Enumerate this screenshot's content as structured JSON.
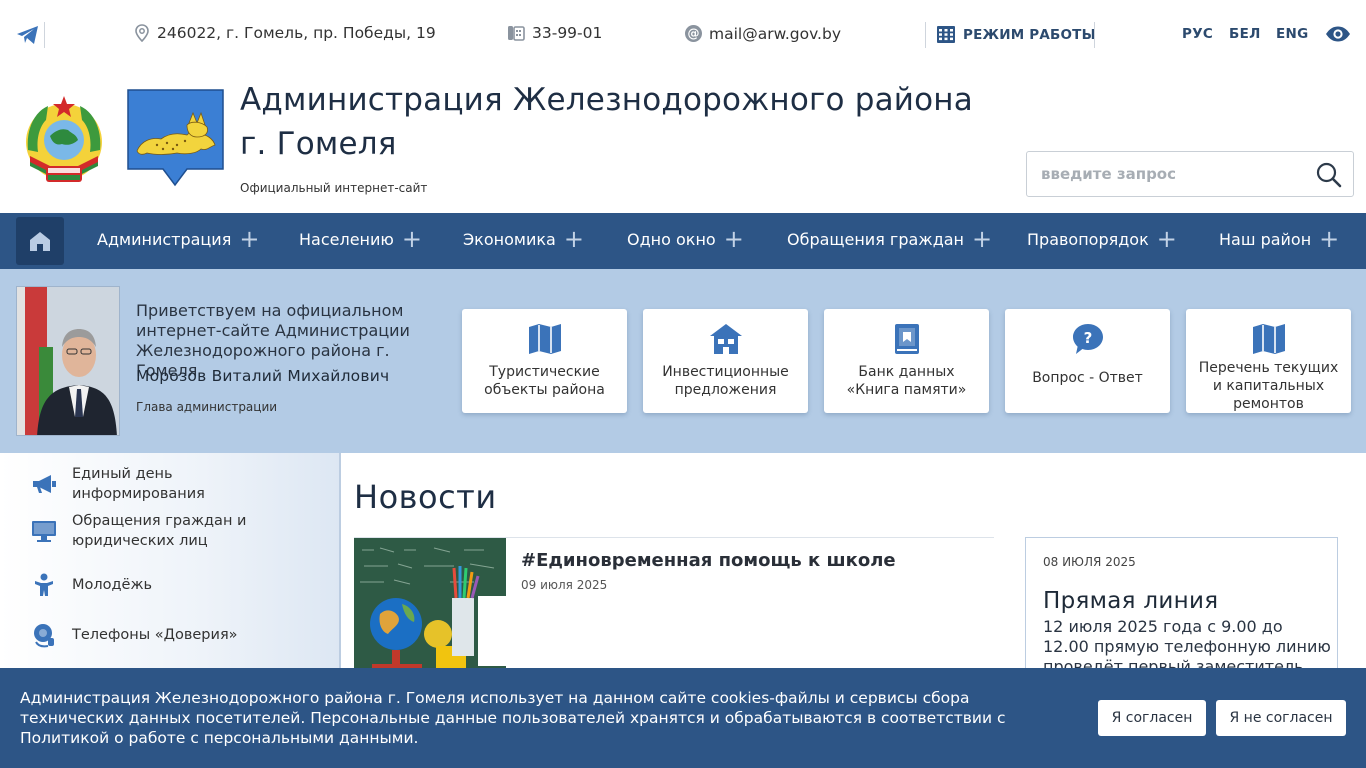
{
  "topbar": {
    "telegram_icon": "telegram-icon",
    "address": "246022, г. Гомель, пр. Победы, 19",
    "phone": "33-99-01",
    "email": "mail@arw.gov.by",
    "hours_label": "РЕЖИМ РАБОТЫ",
    "languages": [
      "РУС",
      "БЕЛ",
      "ENG"
    ],
    "accessibility_icon": "eye-icon"
  },
  "header": {
    "title_line1": "Администрация Железнодорожного района",
    "title_line2": "г. Гомеля",
    "subtitle": "Официальный интернет-сайт",
    "search_placeholder": "введите запрос"
  },
  "nav": {
    "items": [
      {
        "label": "Администрация"
      },
      {
        "label": "Населению"
      },
      {
        "label": "Экономика"
      },
      {
        "label": "Одно окно"
      },
      {
        "label": "Обращения граждан"
      },
      {
        "label": "Правопорядок"
      },
      {
        "label": "Наш район"
      }
    ]
  },
  "hero": {
    "greeting": "Приветствуем на официальном интернет-сайте Администрации Железнодорожного района г. Гомеля",
    "head_name": "Морозов Виталий Михайлович",
    "head_position": "Глава администрации",
    "cards": [
      {
        "label": "Туристические объекты района",
        "icon": "map-icon"
      },
      {
        "label": "Инвестиционные предложения",
        "icon": "building-icon"
      },
      {
        "label": "Банк данных «Книга памяти»",
        "icon": "book-icon"
      },
      {
        "label": "Вопрос - Ответ",
        "icon": "question-bubble-icon"
      },
      {
        "label": "Перечень текущих и капитальных ремонтов",
        "icon": "map-icon"
      }
    ]
  },
  "sidebar": {
    "items": [
      {
        "label": "Единый день информирования",
        "icon": "megaphone-icon"
      },
      {
        "label": "Обращения граждан и юридических лиц",
        "icon": "computer-icon"
      },
      {
        "label": "Молодёжь",
        "icon": "person-icon"
      },
      {
        "label": "Телефоны «Доверия»",
        "icon": "headset-icon"
      }
    ]
  },
  "news": {
    "title": "Новости",
    "item_title": "#Единовременная помощь к школе",
    "item_date": "09 июля 2025"
  },
  "hotline": {
    "date": "08 ИЮЛЯ 2025",
    "title": "Прямая линия",
    "text": "12 июля 2025 года с 9.00 до 12.00 прямую телефонную линию проведёт первый заместитель"
  },
  "cookie": {
    "text": "Администрация Железнодорожного района г. Гомеля использует на данном сайте cookies-файлы и сервисы сбора технических данных посетителей. Персональные данные пользователей хранятся и обрабатываются в соответствии с Политикой о работе с персональными данными.",
    "agree": "Я согласен",
    "disagree": "Я не согласен"
  },
  "colors": {
    "nav_bg": "#2d5586",
    "hero_bg": "#b3cbe5",
    "accent": "#3b73b9"
  }
}
